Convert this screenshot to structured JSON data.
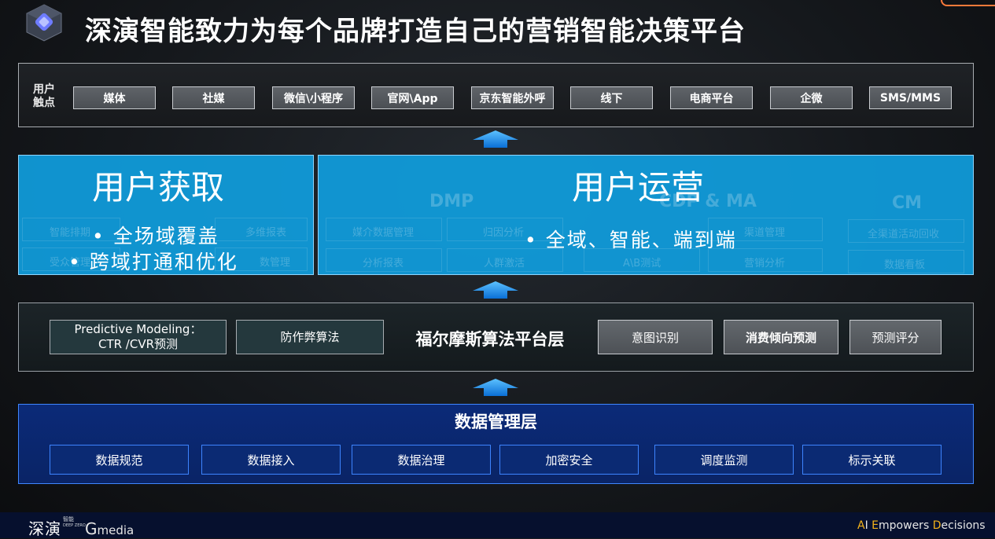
{
  "header": {
    "title": "深演智能致力为每个品牌打造自己的营销智能决策平台"
  },
  "touchpoints": {
    "label_line1": "用户",
    "label_line2": "触点",
    "items": [
      "媒体",
      "社媒",
      "微信\\小程序",
      "官网\\App",
      "京东智能外呼",
      "线下",
      "电商平台",
      "企微",
      "SMS/MMS"
    ]
  },
  "acquisition": {
    "title": "用户获取",
    "bullets": [
      "全场域覆盖",
      "跨域打通和优化"
    ],
    "ghost_items": [
      "智能排期",
      "多维报表",
      "受众管理",
      "数管理"
    ]
  },
  "operation": {
    "title": "用户运营",
    "bullets": [
      "全域、智能、端到端"
    ],
    "ghost_headings": [
      "DMP",
      "CDP & MA",
      "CM"
    ],
    "ghost_items": [
      "媒介数据管理",
      "归因分析",
      "渠道管理",
      "全渠道活动回收",
      "分析报表",
      "人群激活",
      "A\\B测试",
      "营销分析",
      "数据看板"
    ]
  },
  "algorithm": {
    "title": "福尔摩斯算法平台层",
    "left_items": [
      {
        "line1": "Predictive Modeling：",
        "line2": "CTR /CVR预测"
      },
      {
        "line1": "防作弊算法",
        "line2": ""
      }
    ],
    "right_items": [
      "意图识别",
      "消费倾向预测",
      "预测评分"
    ]
  },
  "data_layer": {
    "title": "数据管理层",
    "items": [
      "数据规范",
      "数据接入",
      "数据治理",
      "加密安全",
      "调度监测",
      "标示关联"
    ]
  },
  "footer": {
    "logo_text": "深演",
    "logo_small_1": "智能",
    "logo_small_2": "DEEP ZERO",
    "gmedia_g": "G",
    "gmedia_rest": "media",
    "slogan_A": "A",
    "slogan_I": "I ",
    "slogan_E": "E",
    "slogan_mpowers": "mpowers ",
    "slogan_D": "D",
    "slogan_ecisions": "ecisions"
  },
  "colors": {
    "accent_blue": "#109EDE",
    "data_layer_blue": "#0B2A78",
    "arrow_blue": "#1E90FF",
    "slogan_highlight": "#F3B21A"
  }
}
